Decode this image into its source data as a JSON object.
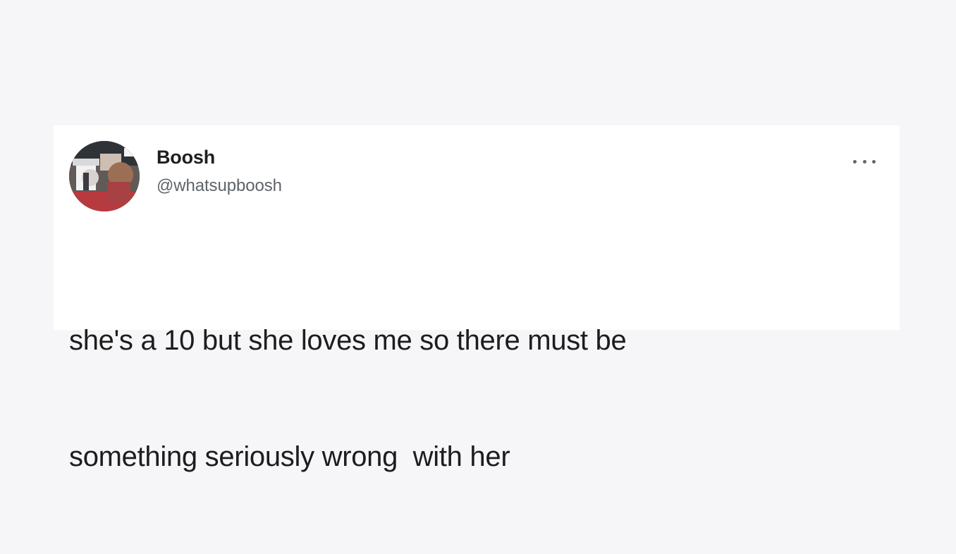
{
  "tweet": {
    "author": {
      "display_name": "Boosh",
      "handle": "@whatsupboosh",
      "avatar_icon": "profile-photo-icon"
    },
    "more_icon": "more-options-icon",
    "text_lines": [
      "she's a 10 but she loves me so there must be",
      "something seriously wrong  with her"
    ]
  }
}
